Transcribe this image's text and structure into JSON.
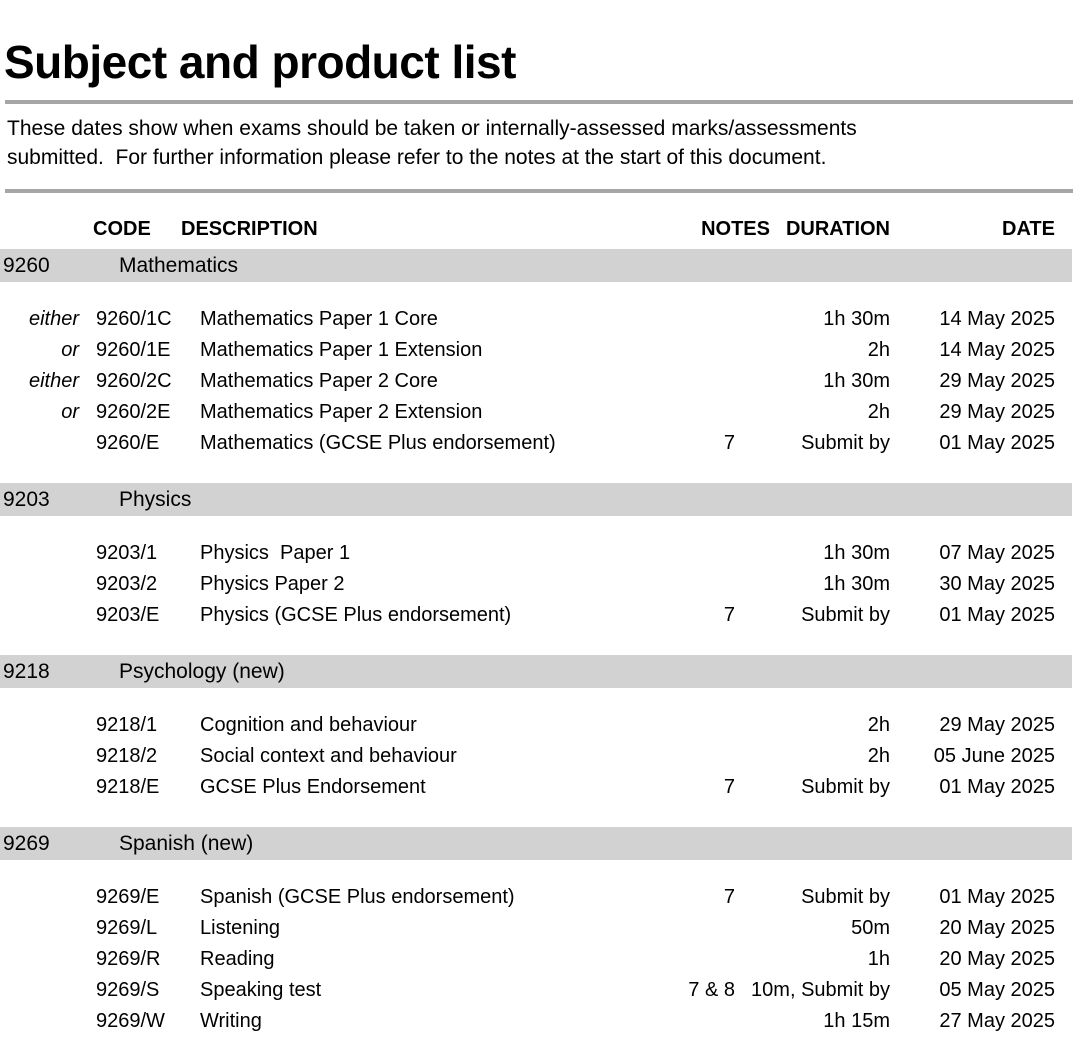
{
  "document": {
    "title": "Subject and product list",
    "intro_lines": [
      "These dates show when exams should be taken or internally-assessed marks/assessments",
      "submitted.  For further information please refer to the notes at the start of this document."
    ]
  },
  "table": {
    "headers": {
      "code": "CODE",
      "description": "DESCRIPTION",
      "notes": "NOTES",
      "duration": "DURATION",
      "date": "DATE"
    },
    "sections": [
      {
        "subject_code": "9260",
        "subject_name": "Mathematics",
        "rows": [
          {
            "prefix": "either",
            "code": "9260/1C",
            "description": "Mathematics Paper 1 Core",
            "notes": "",
            "duration": "1h 30m",
            "date": "14 May 2025"
          },
          {
            "prefix": "or",
            "code": "9260/1E",
            "description": "Mathematics Paper 1 Extension",
            "notes": "",
            "duration": "2h",
            "date": "14 May 2025"
          },
          {
            "prefix": "either",
            "code": "9260/2C",
            "description": "Mathematics Paper 2 Core",
            "notes": "",
            "duration": "1h 30m",
            "date": "29 May 2025"
          },
          {
            "prefix": "or",
            "code": "9260/2E",
            "description": "Mathematics Paper 2 Extension",
            "notes": "",
            "duration": "2h",
            "date": "29 May 2025"
          },
          {
            "prefix": "",
            "code": "9260/E",
            "description": "Mathematics (GCSE Plus endorsement)",
            "notes": "7",
            "duration": "Submit by",
            "date": "01 May 2025"
          }
        ]
      },
      {
        "subject_code": "9203",
        "subject_name": "Physics",
        "rows": [
          {
            "prefix": "",
            "code": "9203/1",
            "description": "Physics  Paper 1",
            "notes": "",
            "duration": "1h 30m",
            "date": "07 May 2025"
          },
          {
            "prefix": "",
            "code": "9203/2",
            "description": "Physics Paper 2",
            "notes": "",
            "duration": "1h 30m",
            "date": "30 May 2025"
          },
          {
            "prefix": "",
            "code": "9203/E",
            "description": "Physics (GCSE Plus endorsement)",
            "notes": "7",
            "duration": "Submit by",
            "date": "01 May 2025"
          }
        ]
      },
      {
        "subject_code": "9218",
        "subject_name": "Psychology (new)",
        "rows": [
          {
            "prefix": "",
            "code": "9218/1",
            "description": "Cognition and behaviour",
            "notes": "",
            "duration": "2h",
            "date": "29 May 2025"
          },
          {
            "prefix": "",
            "code": "9218/2",
            "description": "Social context and behaviour",
            "notes": "",
            "duration": "2h",
            "date": "05 June 2025"
          },
          {
            "prefix": "",
            "code": "9218/E",
            "description": "GCSE Plus Endorsement",
            "notes": "7",
            "duration": "Submit by",
            "date": "01 May 2025"
          }
        ]
      },
      {
        "subject_code": "9269",
        "subject_name": "Spanish (new)",
        "rows": [
          {
            "prefix": "",
            "code": "9269/E",
            "description": "Spanish (GCSE Plus endorsement)",
            "notes": "7",
            "duration": "Submit by",
            "date": "01 May 2025"
          },
          {
            "prefix": "",
            "code": "9269/L",
            "description": "Listening",
            "notes": "",
            "duration": "50m",
            "date": "20 May 2025"
          },
          {
            "prefix": "",
            "code": "9269/R",
            "description": "Reading",
            "notes": "",
            "duration": "1h",
            "date": "20 May 2025"
          },
          {
            "prefix": "",
            "code": "9269/S",
            "description": "Speaking test",
            "notes": "7 & 8",
            "duration": "10m, Submit by",
            "date": "05 May 2025"
          },
          {
            "prefix": "",
            "code": "9269/W",
            "description": "Writing",
            "notes": "",
            "duration": "1h 15m",
            "date": "27 May 2025"
          }
        ]
      }
    ]
  },
  "colors": {
    "rule": "#a6a6a6",
    "subject_band": "#d2d2d2"
  }
}
